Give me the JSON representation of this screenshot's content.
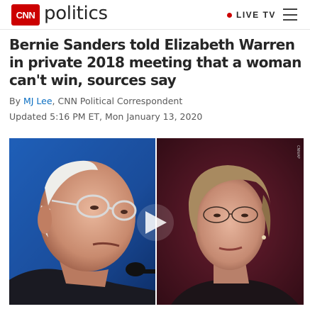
{
  "header": {
    "logo_text": "CNN",
    "section": "politics",
    "live_label": "LIVE TV"
  },
  "article": {
    "headline": "Bernie Sanders told Elizabeth Warren in private 2018 meeting that a woman can't win, sources say",
    "byline_prefix": "By",
    "author": "MJ Lee",
    "author_role": ", CNN Political Correspondent",
    "updated": "Updated 5:16 PM ET, Mon January 13, 2020"
  },
  "media": {
    "credit": "CNN/AP"
  },
  "colors": {
    "brand": "#cc0000",
    "link": "#0c6fc2",
    "text": "#262626"
  }
}
